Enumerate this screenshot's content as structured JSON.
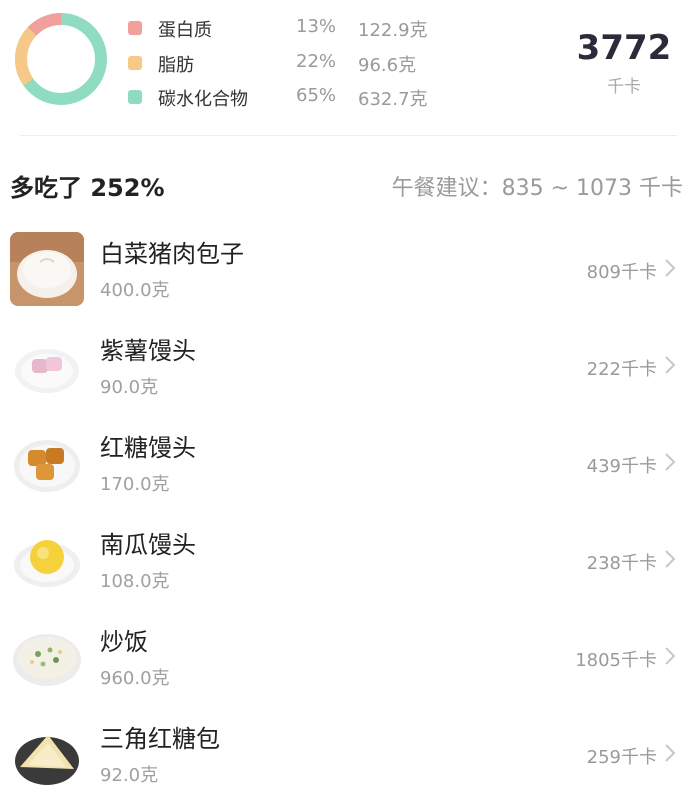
{
  "summary": {
    "macros": [
      {
        "name": "蛋白质",
        "percent": "13%",
        "weight": "122.9克",
        "color": "#f2a09b"
      },
      {
        "name": "脂肪",
        "percent": "22%",
        "weight": "96.6克",
        "color": "#f7c988"
      },
      {
        "name": "碳水化合物",
        "percent": "65%",
        "weight": "632.7克",
        "color": "#8fdcc0"
      }
    ],
    "total_calories": "3772",
    "total_unit": "千卡"
  },
  "meal": {
    "over_label": "多吃了 252%",
    "suggestion": "午餐建议：835 ~ 1073 千卡"
  },
  "foods": [
    {
      "name": "白菜猪肉包子",
      "weight": "400.0克",
      "calories": "809千卡"
    },
    {
      "name": "紫薯馒头",
      "weight": "90.0克",
      "calories": "222千卡"
    },
    {
      "name": "红糖馒头",
      "weight": "170.0克",
      "calories": "439千卡"
    },
    {
      "name": "南瓜馒头",
      "weight": "108.0克",
      "calories": "238千卡"
    },
    {
      "name": "炒饭",
      "weight": "960.0克",
      "calories": "1805千卡"
    },
    {
      "name": "三角红糖包",
      "weight": "92.0克",
      "calories": "259千卡"
    }
  ]
}
